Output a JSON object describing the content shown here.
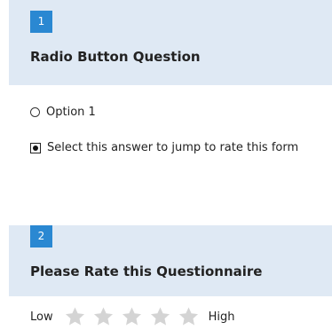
{
  "questions": [
    {
      "number": "1",
      "title": "Radio Button Question",
      "options": [
        {
          "label": "Option 1",
          "selected": false
        },
        {
          "label": "Select this answer to jump to rate this form",
          "selected": true
        }
      ]
    },
    {
      "number": "2",
      "title": "Please Rate this Questionnaire",
      "rating": {
        "low_label": "Low",
        "high_label": "High",
        "max_stars": 5,
        "value": 0
      }
    }
  ],
  "colors": {
    "header_bg": "#dfe9f4",
    "number_badge": "#2a88d2",
    "star_empty": "#d4d4d4"
  }
}
